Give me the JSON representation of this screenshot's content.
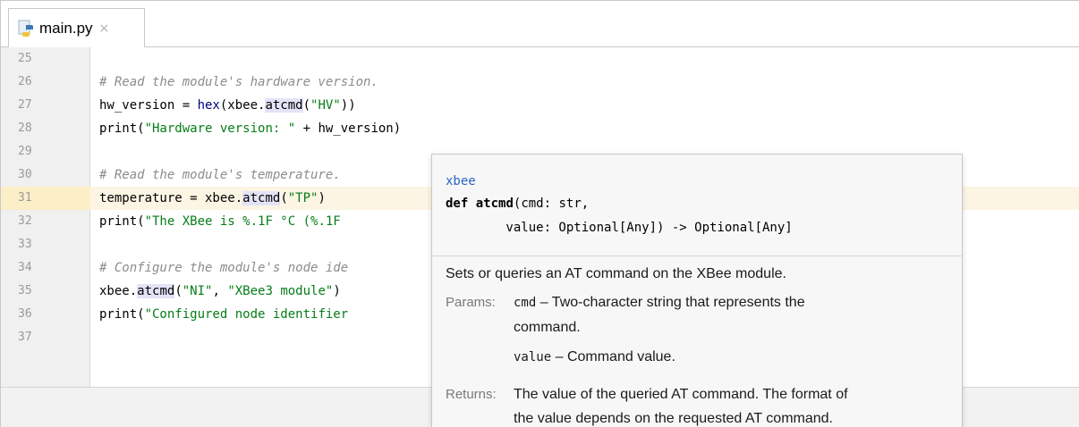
{
  "tab": {
    "filename": "main.py",
    "close_glyph": "×",
    "icon": "python-file-icon"
  },
  "editor": {
    "current_line": 31,
    "lines": [
      {
        "num": "25",
        "code": ""
      },
      {
        "num": "26",
        "code": "# Read the module's hardware version."
      },
      {
        "num": "27",
        "code": "hw_version = hex(xbee.atcmd(\"HV\"))"
      },
      {
        "num": "28",
        "code": "print(\"Hardware version: \" + hw_version)"
      },
      {
        "num": "29",
        "code": ""
      },
      {
        "num": "30",
        "code": "# Read the module's temperature."
      },
      {
        "num": "31",
        "code": "temperature = xbee.atcmd(\"TP\")"
      },
      {
        "num": "32",
        "code": "print(\"The XBee is %.1F °C (%.1F"
      },
      {
        "num": "33",
        "code": ""
      },
      {
        "num": "34",
        "code": "# Configure the module's node ide"
      },
      {
        "num": "35",
        "code": "xbee.atcmd(\"NI\", \"XBee3 module\")"
      },
      {
        "num": "36",
        "code": "print(\"Configured node identifier"
      },
      {
        "num": "37",
        "code": ""
      }
    ]
  },
  "doc_popup": {
    "module": "xbee",
    "signature_line1_kw": "def",
    "signature_line1_name": "atcmd",
    "signature_line1_rest": "(cmd: str,",
    "signature_line2": "        value: Optional[Any]) -> Optional[Any]",
    "description": "Sets or queries an AT command on the XBee module.",
    "params_label": "Params:",
    "param1_name": "cmd",
    "param1_desc": " – Two-character string that represents the",
    "param1_desc2": "command.",
    "param2_name": "value",
    "param2_desc": " – Command value.",
    "returns_label": "Returns:",
    "returns_line1": "The value of the queried AT command. The format of",
    "returns_line2": "the value depends on the requested AT command."
  },
  "colors": {
    "current_line_bg": "#fcf5e4",
    "comment": "#8c8c8c",
    "string": "#067d17",
    "module_link": "#2a62c0",
    "gutter_bg": "#f0f0f0"
  }
}
